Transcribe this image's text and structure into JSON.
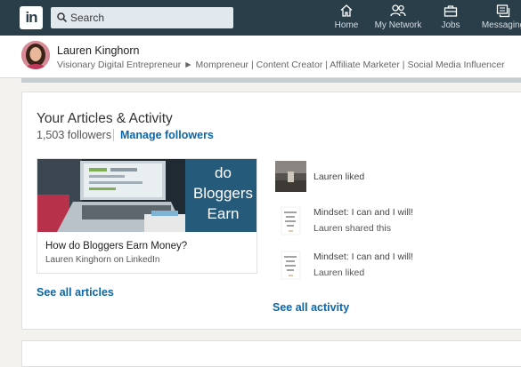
{
  "nav": {
    "logo_text": "in",
    "search_placeholder": "Search",
    "items": [
      {
        "label": "Home",
        "icon": "home-icon"
      },
      {
        "label": "My Network",
        "icon": "network-icon"
      },
      {
        "label": "Jobs",
        "icon": "briefcase-icon"
      },
      {
        "label": "Messaging",
        "icon": "messaging-icon"
      }
    ]
  },
  "profile": {
    "name": "Lauren Kinghorn",
    "headline": "Visionary Digital Entrepreneur ► Mompreneur | Content Creator | Affiliate Marketer | Social Media Influencer"
  },
  "articles_section": {
    "title": "Your Articles & Activity",
    "followers": "1,503 followers",
    "manage_link": "Manage followers",
    "article": {
      "image_text_line1": "do",
      "image_text_line2": "Bloggers",
      "image_text_line3": "Earn",
      "title": "How do Bloggers Earn Money?",
      "author": "Lauren Kinghorn on LinkedIn"
    },
    "see_all_articles": "See all articles",
    "activity": [
      {
        "line1": "Lauren liked",
        "line2": ""
      },
      {
        "line1": "Mindset: I can and I will!",
        "line2": "Lauren shared this",
        "thumb_text": "Mindset: I can & I will!"
      },
      {
        "line1": "Mindset: I can and I will!",
        "line2": "Lauren liked",
        "thumb_text": "Mindset: I can & I will!"
      }
    ],
    "see_all_activity": "See all activity"
  },
  "colors": {
    "nav_bg": "#293e49",
    "link": "#0a66a8",
    "page_bg": "#f3f2ef"
  }
}
